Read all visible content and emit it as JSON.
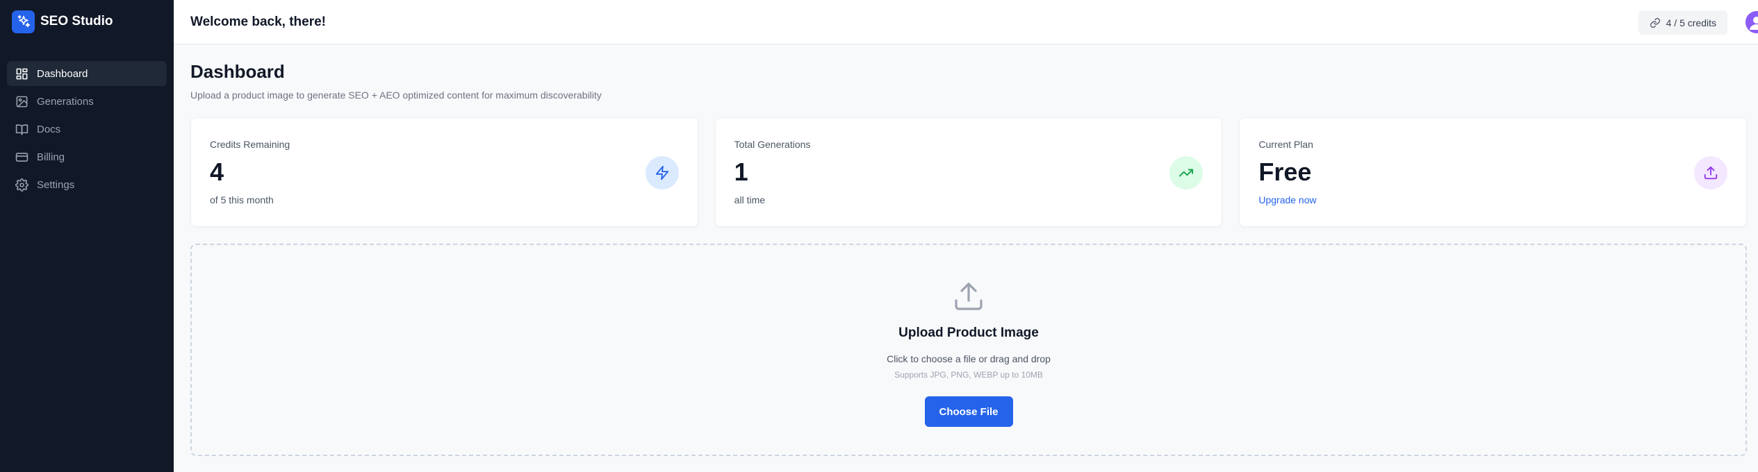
{
  "app": {
    "name": "SEO Studio"
  },
  "sidebar": {
    "items": [
      {
        "label": "Dashboard",
        "icon": "dashboard-icon",
        "active": true
      },
      {
        "label": "Generations",
        "icon": "image-icon"
      },
      {
        "label": "Docs",
        "icon": "book-icon"
      },
      {
        "label": "Billing",
        "icon": "credit-card-icon"
      },
      {
        "label": "Settings",
        "icon": "gear-icon"
      }
    ]
  },
  "header": {
    "welcome": "Welcome back, there!",
    "credits": "4 / 5 credits",
    "credits_icon": "link-icon"
  },
  "page": {
    "title": "Dashboard",
    "subtitle": "Upload a product image to generate SEO + AEO optimized content for maximum discoverability"
  },
  "stats": {
    "credits": {
      "label": "Credits Remaining",
      "value": "4",
      "sub": "of 5 this month",
      "icon": "lightning-icon",
      "color": "#2563eb",
      "bg": "#dbeafe"
    },
    "generations": {
      "label": "Total Generations",
      "value": "1",
      "sub": "all time",
      "icon": "trending-up-icon",
      "color": "#16a34a",
      "bg": "#dcfce7"
    },
    "plan": {
      "label": "Current Plan",
      "value": "Free",
      "link": "Upgrade now",
      "icon": "upload-icon",
      "color": "#9333ea",
      "bg": "#f3e8ff"
    }
  },
  "upload": {
    "title": "Upload Product Image",
    "description": "Click to choose a file or drag and drop",
    "hint": "Supports JPG, PNG, WEBP up to 10MB",
    "button": "Choose File"
  },
  "colors": {
    "sidebar_bg": "#111827",
    "accent": "#2563eb"
  }
}
